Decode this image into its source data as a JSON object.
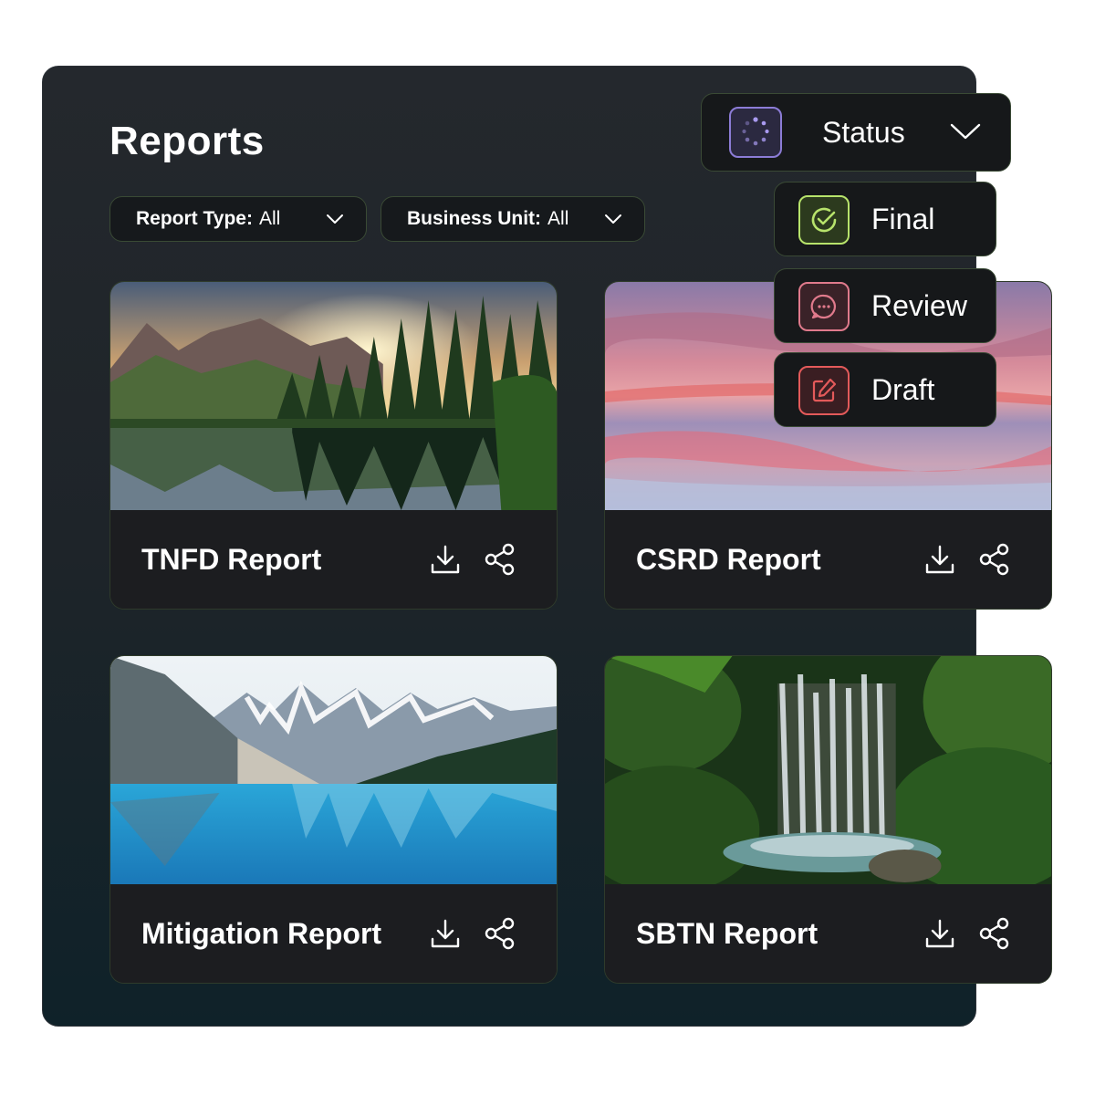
{
  "page": {
    "title": "Reports"
  },
  "filters": [
    {
      "key": "Report Type:",
      "value": "All"
    },
    {
      "key": "Business Unit:",
      "value": "All"
    }
  ],
  "status_menu": {
    "label": "Status",
    "options": [
      {
        "label": "Final",
        "icon": "check-circle-icon",
        "color": "#b7e36b"
      },
      {
        "label": "Review",
        "icon": "chat-bubble-icon",
        "color": "#e07a8c"
      },
      {
        "label": "Draft",
        "icon": "edit-icon",
        "color": "#e35a5a"
      }
    ]
  },
  "cards": [
    {
      "title": "TNFD Report",
      "image": "mountain lake forest sunset"
    },
    {
      "title": "CSRD Report",
      "image": "pink sky reflection"
    },
    {
      "title": "Mitigation Report",
      "image": "turquoise mountain lake"
    },
    {
      "title": "SBTN Report",
      "image": "jungle waterfall"
    }
  ],
  "colors": {
    "accent_border": "#3a4a35",
    "panel": "#1e2429",
    "card": "#1c1d20"
  }
}
